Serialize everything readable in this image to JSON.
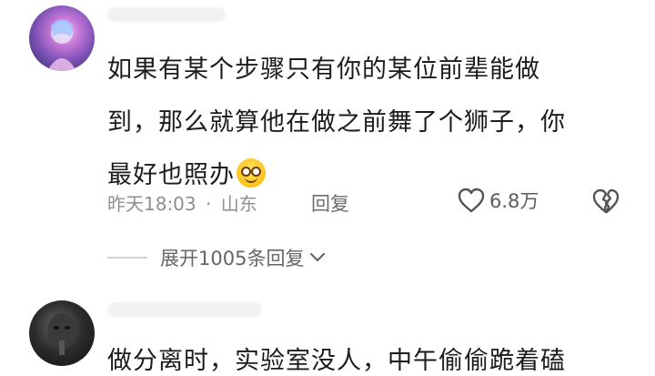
{
  "comments": [
    {
      "avatar": "avatar-anime-girl",
      "text_lines": [
        "如果有某个步骤只有你的某位前辈能做",
        "到，那么就算他在做之前舞了个狮子，你",
        "最好也照办"
      ],
      "emoji": "grinning-face-emoji",
      "time": "昨天18:03",
      "separator": "·",
      "location": "山东",
      "reply_label": "回复",
      "likes": "6.8万",
      "expand_label": "展开1005条回复"
    },
    {
      "avatar": "avatar-dark-person",
      "text": "做分离时，实验室没人，中午偷偷跪着磕"
    }
  ],
  "icons": {
    "like": "heart-icon",
    "dislike": "broken-heart-icon",
    "expand": "chevron-down-icon"
  },
  "colors": {
    "text": "#1c1c1c",
    "meta": "#8f8f8f",
    "background": "#ffffff"
  }
}
